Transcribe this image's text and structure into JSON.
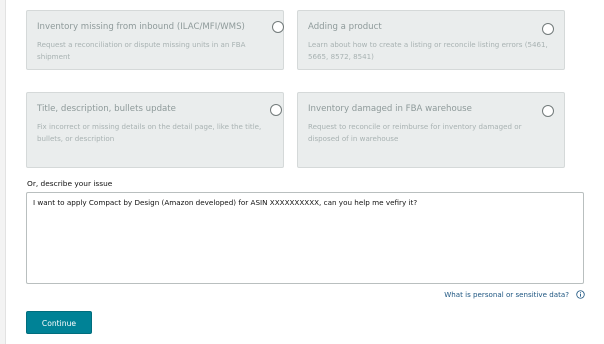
{
  "options": [
    {
      "title": "Inventory missing from inbound (ILAC/MFI/WMS)",
      "description": "Request a reconciliation or dispute missing units in an FBA shipment"
    },
    {
      "title": "Adding a product",
      "description": "Learn about how to create a listing or reconcile listing errors (5461, 5665, 8572, 8541)"
    },
    {
      "title": "Title, description, bullets update",
      "description": "Fix incorrect or missing details on the detail page, like the title, bullets, or description"
    },
    {
      "title": "Inventory damaged in FBA warehouse",
      "description": "Request to reconcile or reimburse for inventory damaged or disposed of in warehouse"
    }
  ],
  "issue": {
    "label": "Or, describe your issue",
    "value": "I want to apply Compact by Design (Amazon developed) for ASIN XXXXXXXXXX, can you help me vefiry it?"
  },
  "help": {
    "sensitive_link": "What is personal or sensitive data?",
    "info_icon": "info-icon"
  },
  "actions": {
    "continue_label": "Continue"
  },
  "colors": {
    "card_background": "#eaeded",
    "continue_button": "#008296",
    "link": "#1d5580"
  }
}
